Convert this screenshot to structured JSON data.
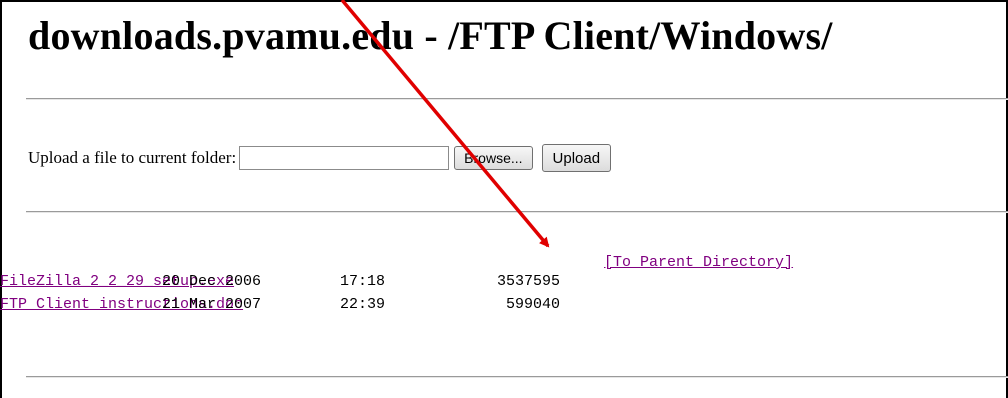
{
  "page": {
    "title": "downloads.pvamu.edu - /FTP Client/Windows/"
  },
  "upload": {
    "label": "Upload a file to current folder:",
    "file_value": "",
    "browse_label": "Browse...",
    "upload_label": "Upload"
  },
  "listing": {
    "parent_link": "[To Parent Directory]",
    "files": [
      {
        "date": "20 Dec 2006",
        "time": "17:18",
        "size": "3537595",
        "name": "FileZilla_2_2_29_setup.exe"
      },
      {
        "date": "21 Mar 2007",
        "time": "22:39",
        "size": "599040",
        "name": "FTP Client instructions.doc"
      }
    ]
  },
  "annotation": {
    "arrow_color": "#e00000"
  },
  "colors": {
    "visited_link": "#800080",
    "rule": "#9a9a9a"
  }
}
